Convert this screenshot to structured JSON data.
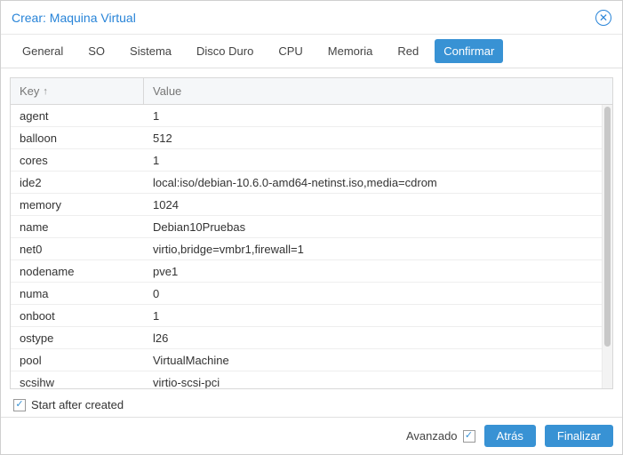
{
  "titlebar": {
    "title": "Crear: Maquina Virtual"
  },
  "tabs": {
    "general": "General",
    "so": "SO",
    "sistema": "Sistema",
    "disco_duro": "Disco Duro",
    "cpu": "CPU",
    "memoria": "Memoria",
    "red": "Red",
    "confirmar": "Confirmar"
  },
  "grid": {
    "headers": {
      "key": "Key",
      "sort_arrow": "↑",
      "value": "Value"
    },
    "rows": [
      {
        "key": "agent",
        "value": "1"
      },
      {
        "key": "balloon",
        "value": "512"
      },
      {
        "key": "cores",
        "value": "1"
      },
      {
        "key": "ide2",
        "value": "local:iso/debian-10.6.0-amd64-netinst.iso,media=cdrom"
      },
      {
        "key": "memory",
        "value": "1024"
      },
      {
        "key": "name",
        "value": "Debian10Pruebas"
      },
      {
        "key": "net0",
        "value": "virtio,bridge=vmbr1,firewall=1"
      },
      {
        "key": "nodename",
        "value": "pve1"
      },
      {
        "key": "numa",
        "value": "0"
      },
      {
        "key": "onboot",
        "value": "1"
      },
      {
        "key": "ostype",
        "value": "l26"
      },
      {
        "key": "pool",
        "value": "VirtualMachine"
      },
      {
        "key": "scsihw",
        "value": "virtio-scsi-pci"
      }
    ]
  },
  "start_after": {
    "label": "Start after created",
    "checked": true
  },
  "footer": {
    "advanced_label": "Avanzado",
    "advanced_checked": true,
    "back": "Atrás",
    "finish": "Finalizar"
  }
}
